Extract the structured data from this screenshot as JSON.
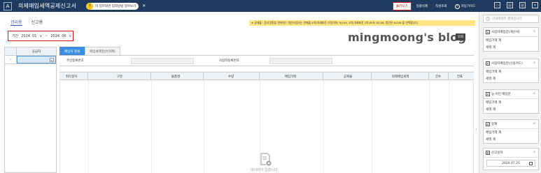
{
  "topbar": {
    "logo": "A",
    "title": "의제매입세액공제신고서",
    "help_num": "?",
    "help_text": "이 업무화면 입력방법 알아보기",
    "help_close": "✕",
    "btn_add": "불러오기",
    "btn_delete": "일괄삭제",
    "btn_print": "작성조회",
    "btn_guide": "자동가이드",
    "guide_icon": "question-icon"
  },
  "tabs": [
    "관리용",
    "신고용"
  ],
  "notice": "※ 공제율 : 음식업종을 영위하는 개인사업자는 연매출 4억(과세표준 2억)이하: 9/109, 4억(과세표준 2억)초과: 8/108, 법인은 6/106 을 선택합니다.",
  "period": {
    "label": "기간",
    "from": "2024. 01",
    "to": "2024. 06",
    "sep": "~",
    "arrow": "∨"
  },
  "blog": "mingmoong's blog",
  "search_btn": "조회",
  "left_panel": {
    "header": "공급자",
    "row_arrow": "›",
    "dd": "▾"
  },
  "sub_tabs": [
    "매입처 명세",
    "매입세액정산(의제)"
  ],
  "form": {
    "resident_no": "주민등록번호",
    "biz_no": "사업자등록번호"
  },
  "grid_headers": [
    "취득일자",
    "구분",
    "물품명",
    "수량",
    "매입가액",
    "공제율",
    "의제매입세액",
    "건수",
    "전표"
  ],
  "empty_text": "데이터가 없습니다.",
  "sidebar": {
    "top": "안내메세지 펼쳐입니다",
    "cards": [
      {
        "title": "사업자매입분(계산서)",
        "rows": [
          "매입가액 계",
          "세액 계"
        ]
      },
      {
        "title": "사업자매입분(신용카드)",
        "rows": [
          "매입가액 계",
          "세액 계"
        ]
      },
      {
        "title": "농·어민 매입분",
        "rows": [
          "매입가액 계",
          "세액 계"
        ]
      },
      {
        "title": "합계",
        "rows": [
          "매입가액 계",
          "세액 계"
        ]
      }
    ],
    "date_card": {
      "title": "신고일자",
      "value": "2024.07.25"
    }
  }
}
